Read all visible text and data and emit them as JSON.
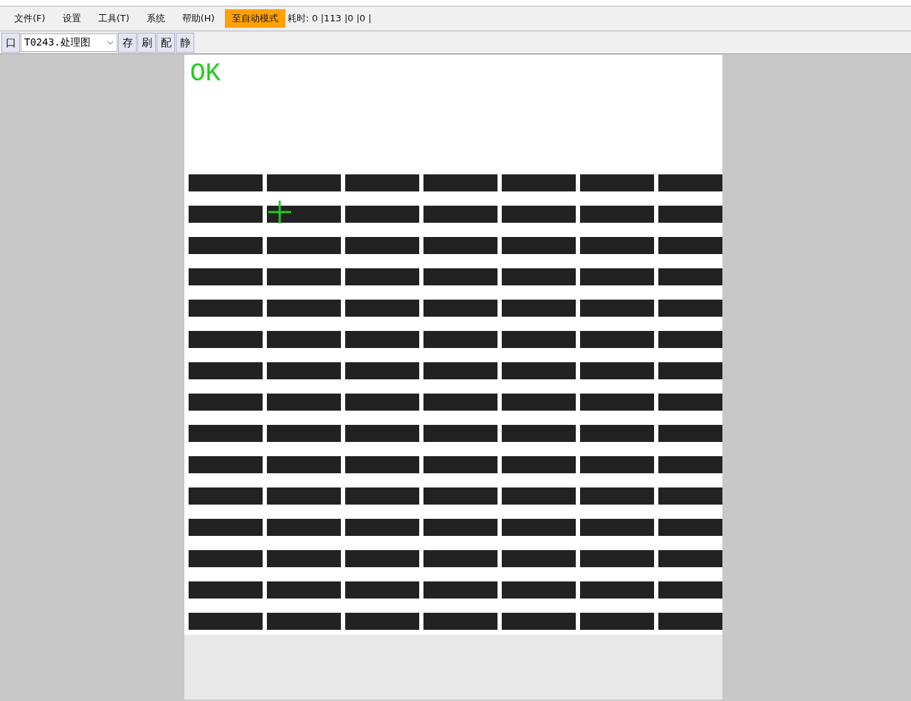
{
  "menu_bar": {
    "items": [
      {
        "label": "文件(F)"
      },
      {
        "label": "设置"
      },
      {
        "label": "工具(T)"
      },
      {
        "label": "系统"
      },
      {
        "label": "帮助(H)"
      }
    ],
    "mode_button": "至自动模式",
    "timing": "耗时: 0 |113 |0 |0 |"
  },
  "toolbar": {
    "toggle": "口",
    "task_select": {
      "value": "T0243.处理图"
    },
    "buttons": [
      "存",
      "刷",
      "配",
      "静"
    ]
  },
  "image_view": {
    "result": "OK"
  }
}
